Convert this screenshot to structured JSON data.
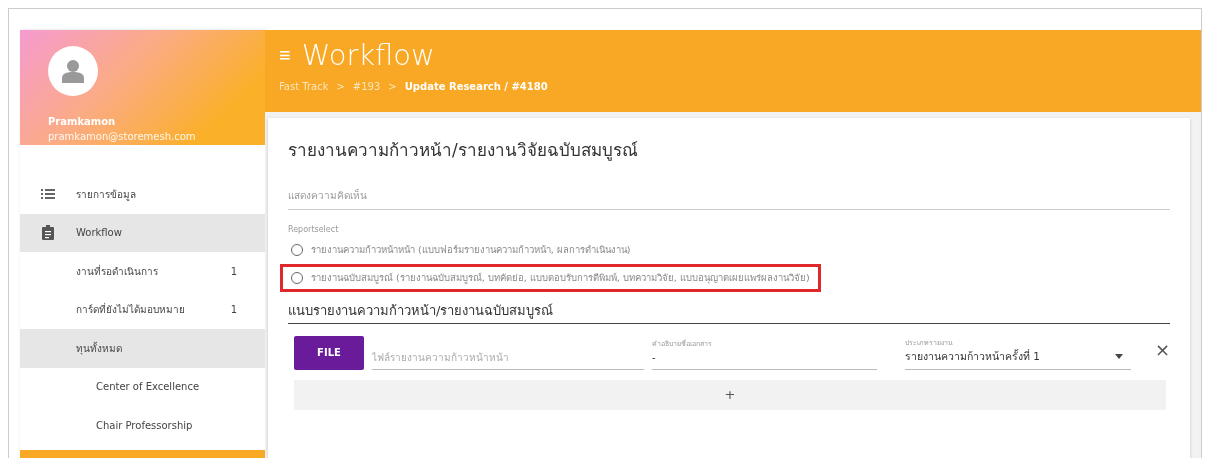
{
  "sidebar": {
    "user": {
      "name": "Pramkamon",
      "email": "pramkamon@storemesh.com"
    },
    "items": [
      {
        "label": "รายการข้อมูล",
        "selected": false
      },
      {
        "label": "Workflow",
        "selected": true,
        "children": [
          {
            "label": "งานที่รอดำเนินการ",
            "count": "1",
            "selected": false
          },
          {
            "label": "การ์ดที่ยังไม่ได้มอบหมาย",
            "count": "1",
            "selected": false
          },
          {
            "label": "ทุนทั้งหมด",
            "selected": true,
            "children": [
              {
                "label": "Center of Excellence",
                "selected": false
              },
              {
                "label": "Chair Professorship",
                "selected": false
              }
            ]
          }
        ]
      }
    ]
  },
  "header": {
    "menu_icon": "≡",
    "title": "Workflow",
    "breadcrumb": [
      {
        "label": "Fast Track",
        "current": false
      },
      {
        "label": "#193",
        "current": false
      },
      {
        "label": "Update Research / #4180",
        "current": true
      }
    ],
    "separator": ">"
  },
  "form": {
    "title": "รายงานความก้าวหน้า/รายงานวิจัยฉบับสมบูรณ์",
    "comment": {
      "placeholder": "แสดงความคิดเห็น"
    },
    "report_select": {
      "label": "Reportselect",
      "options": [
        {
          "label": "รายงานความก้าวหน้าหน้า (แบบฟอร์มรายงานความก้าวหน้า, ผลการดำเนินงาน)",
          "selected": false,
          "highlighted": false
        },
        {
          "label": "รายงานฉบับสมบูรณ์ (รายงานฉบับสมบูรณ์, บทคัดย่อ, แบบตอบรับการตีพิมพ์, บทความวิจัย, แบบอนุญาตเผยแพร่ผลงานวิจัย)",
          "selected": false,
          "highlighted": true
        }
      ]
    },
    "attachments": {
      "title": "แนบรายงานความก้าวหน้า/รายงานฉบับสมบูรณ์",
      "rows": [
        {
          "file_button": "FILE",
          "file": {
            "placeholder": "ไฟล์รายงานความก้าวหน้าหน้า"
          },
          "description": {
            "label": "คำอธิบายชื่อเอกสาร",
            "value": "-"
          },
          "type": {
            "label": "ประเภทรายงาน",
            "value": "รายงานความก้าวหน้าครั้งที่ 1"
          },
          "remove": "×"
        }
      ],
      "add": "+"
    }
  }
}
